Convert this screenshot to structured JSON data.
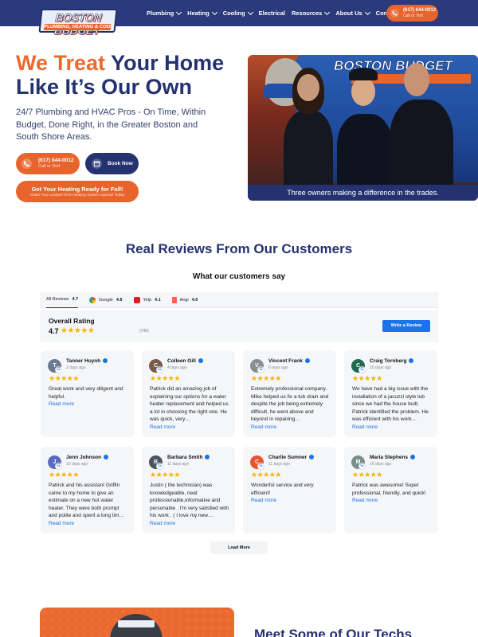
{
  "nav": {
    "logo_line1": "BOSTON BUDGET",
    "logo_line2": "PLUMBING, HEATING & COOLING",
    "menu": [
      {
        "label": "Plumbing",
        "dropdown": true
      },
      {
        "label": "Heating",
        "dropdown": true
      },
      {
        "label": "Cooling",
        "dropdown": true
      },
      {
        "label": "Electrical",
        "dropdown": false
      },
      {
        "label": "Resources",
        "dropdown": true
      },
      {
        "label": "About Us",
        "dropdown": true
      },
      {
        "label": "Contact Us",
        "dropdown": false
      }
    ],
    "cta_phone": "(617) 644-0012",
    "cta_sub": "Call or Text"
  },
  "hero": {
    "title_accent": "We Treat",
    "title_rest": " Your Home Like It’s Our Own",
    "subtitle": "24/7 Plumbing and HVAC Pros - On Time, Within Budget, Done Right, in the Greater Boston and South Shore Areas.",
    "call_phone": "(617) 644-0012",
    "call_sub": "Call or Text",
    "book_label": "Book Now",
    "fall_label": "Get Your Heating Ready for Fall!",
    "fall_sub": "Claim Your Limited-Time Heating System Special Today",
    "truck_text": "BOSTON BUDGET",
    "photo_caption": "Three owners making a difference in the trades."
  },
  "reviews": {
    "heading": "Real Reviews From Our Customers",
    "subheading": "What our customers say",
    "tabs": [
      {
        "label": "All Reviews",
        "value": "4.7",
        "color": ""
      },
      {
        "label": "Google",
        "value": "4.8",
        "color": "#4285f4"
      },
      {
        "label": "Yelp",
        "value": "4.1",
        "color": "#d32323"
      },
      {
        "label": "Angi",
        "value": "4.6",
        "color": "#ff6153"
      }
    ],
    "overall_title": "Overall Rating",
    "overall_value": "4.7",
    "overall_stars": "★★★★★",
    "overall_count": "(745)",
    "write_label": "Write a Review",
    "read_more": "Read more",
    "load_more": "Load More",
    "cards": [
      {
        "name": "Tanner Huynh",
        "date": "2 days ago",
        "initial": "T",
        "avatar_color": "#6b7a8f",
        "stars": "★★★★★",
        "text": "Great work and very diligent and helpful."
      },
      {
        "name": "Colleen Gill",
        "date": "4 days ago",
        "initial": "C",
        "avatar_color": "#7a5a4a",
        "stars": "★★★★★",
        "text": "Patrick did an amazing job of explaining our options for a water heater replacement and helped us a lot in choosing the right one. He was quick, very…"
      },
      {
        "name": "Vincent Frank",
        "date": "6 days ago",
        "initial": "V",
        "avatar_color": "#8a8d92",
        "stars": "★★★★★",
        "text": "Extremely professional company. Mike helped us fix a tub drain and despite the job being extremely difficult, he went above and beyond in repairing…"
      },
      {
        "name": "Craig Tornberg",
        "date": "10 days ago",
        "initial": "C",
        "avatar_color": "#1e6b4f",
        "stars": "★★★★★",
        "text": "We have had a big issue with the installation of a jacuzzi style tub since we had the house built. Patrick identified the problem. He was efficient with his work…"
      },
      {
        "name": "Jenn Johnson",
        "date": "10 days ago",
        "initial": "J",
        "avatar_color": "#5c6bc0",
        "stars": "★★★★★",
        "text": "Patrick and his assistant Griffin came to my home to give an estimate on a new hot water heater. They were both prompt and polite and spent a long tim…"
      },
      {
        "name": "Barbara Smith",
        "date": "11 days ago",
        "initial": "B",
        "avatar_color": "#4a5560",
        "stars": "★★★★★",
        "text": "Justin ( the technician) was knowledgeable, neat professionable,informative and personable . I'm very satisfied with his work . ( I love my new…"
      },
      {
        "name": "Charlie Sumner",
        "date": "11 days ago",
        "initial": "C",
        "avatar_color": "#e8542f",
        "stars": "★★★★★",
        "text": "Wonderful service and very efficient!"
      },
      {
        "name": "Maria Stephens",
        "date": "16 days ago",
        "initial": "M",
        "avatar_color": "#7b8f8a",
        "stars": "★★★★★",
        "text": "Patrick was awesome! Super professional, friendly, and quick!"
      }
    ]
  },
  "techs": {
    "heading": "Meet Some of Our Techs"
  }
}
